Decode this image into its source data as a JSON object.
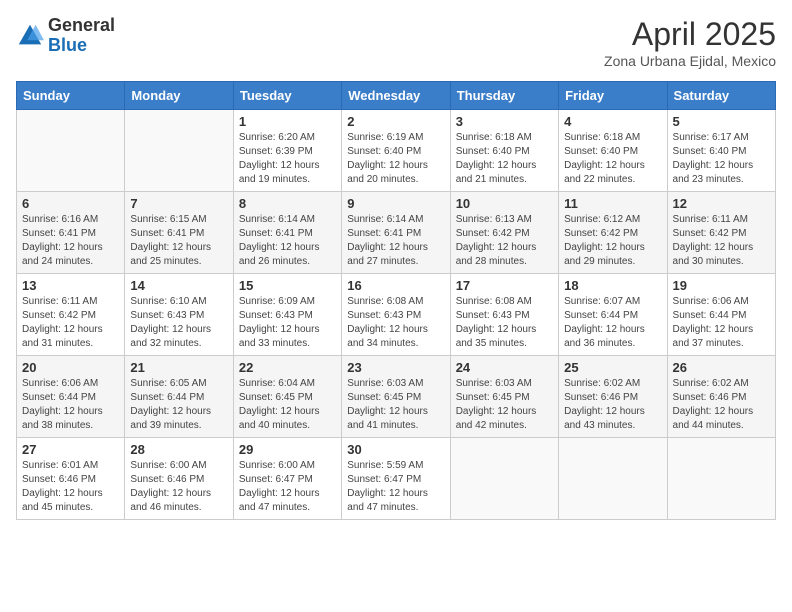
{
  "logo": {
    "general": "General",
    "blue": "Blue"
  },
  "title": "April 2025",
  "subtitle": "Zona Urbana Ejidal, Mexico",
  "headers": [
    "Sunday",
    "Monday",
    "Tuesday",
    "Wednesday",
    "Thursday",
    "Friday",
    "Saturday"
  ],
  "rows": [
    [
      {
        "day": "",
        "info": ""
      },
      {
        "day": "",
        "info": ""
      },
      {
        "day": "1",
        "info": "Sunrise: 6:20 AM\nSunset: 6:39 PM\nDaylight: 12 hours and 19 minutes."
      },
      {
        "day": "2",
        "info": "Sunrise: 6:19 AM\nSunset: 6:40 PM\nDaylight: 12 hours and 20 minutes."
      },
      {
        "day": "3",
        "info": "Sunrise: 6:18 AM\nSunset: 6:40 PM\nDaylight: 12 hours and 21 minutes."
      },
      {
        "day": "4",
        "info": "Sunrise: 6:18 AM\nSunset: 6:40 PM\nDaylight: 12 hours and 22 minutes."
      },
      {
        "day": "5",
        "info": "Sunrise: 6:17 AM\nSunset: 6:40 PM\nDaylight: 12 hours and 23 minutes."
      }
    ],
    [
      {
        "day": "6",
        "info": "Sunrise: 6:16 AM\nSunset: 6:41 PM\nDaylight: 12 hours and 24 minutes."
      },
      {
        "day": "7",
        "info": "Sunrise: 6:15 AM\nSunset: 6:41 PM\nDaylight: 12 hours and 25 minutes."
      },
      {
        "day": "8",
        "info": "Sunrise: 6:14 AM\nSunset: 6:41 PM\nDaylight: 12 hours and 26 minutes."
      },
      {
        "day": "9",
        "info": "Sunrise: 6:14 AM\nSunset: 6:41 PM\nDaylight: 12 hours and 27 minutes."
      },
      {
        "day": "10",
        "info": "Sunrise: 6:13 AM\nSunset: 6:42 PM\nDaylight: 12 hours and 28 minutes."
      },
      {
        "day": "11",
        "info": "Sunrise: 6:12 AM\nSunset: 6:42 PM\nDaylight: 12 hours and 29 minutes."
      },
      {
        "day": "12",
        "info": "Sunrise: 6:11 AM\nSunset: 6:42 PM\nDaylight: 12 hours and 30 minutes."
      }
    ],
    [
      {
        "day": "13",
        "info": "Sunrise: 6:11 AM\nSunset: 6:42 PM\nDaylight: 12 hours and 31 minutes."
      },
      {
        "day": "14",
        "info": "Sunrise: 6:10 AM\nSunset: 6:43 PM\nDaylight: 12 hours and 32 minutes."
      },
      {
        "day": "15",
        "info": "Sunrise: 6:09 AM\nSunset: 6:43 PM\nDaylight: 12 hours and 33 minutes."
      },
      {
        "day": "16",
        "info": "Sunrise: 6:08 AM\nSunset: 6:43 PM\nDaylight: 12 hours and 34 minutes."
      },
      {
        "day": "17",
        "info": "Sunrise: 6:08 AM\nSunset: 6:43 PM\nDaylight: 12 hours and 35 minutes."
      },
      {
        "day": "18",
        "info": "Sunrise: 6:07 AM\nSunset: 6:44 PM\nDaylight: 12 hours and 36 minutes."
      },
      {
        "day": "19",
        "info": "Sunrise: 6:06 AM\nSunset: 6:44 PM\nDaylight: 12 hours and 37 minutes."
      }
    ],
    [
      {
        "day": "20",
        "info": "Sunrise: 6:06 AM\nSunset: 6:44 PM\nDaylight: 12 hours and 38 minutes."
      },
      {
        "day": "21",
        "info": "Sunrise: 6:05 AM\nSunset: 6:44 PM\nDaylight: 12 hours and 39 minutes."
      },
      {
        "day": "22",
        "info": "Sunrise: 6:04 AM\nSunset: 6:45 PM\nDaylight: 12 hours and 40 minutes."
      },
      {
        "day": "23",
        "info": "Sunrise: 6:03 AM\nSunset: 6:45 PM\nDaylight: 12 hours and 41 minutes."
      },
      {
        "day": "24",
        "info": "Sunrise: 6:03 AM\nSunset: 6:45 PM\nDaylight: 12 hours and 42 minutes."
      },
      {
        "day": "25",
        "info": "Sunrise: 6:02 AM\nSunset: 6:46 PM\nDaylight: 12 hours and 43 minutes."
      },
      {
        "day": "26",
        "info": "Sunrise: 6:02 AM\nSunset: 6:46 PM\nDaylight: 12 hours and 44 minutes."
      }
    ],
    [
      {
        "day": "27",
        "info": "Sunrise: 6:01 AM\nSunset: 6:46 PM\nDaylight: 12 hours and 45 minutes."
      },
      {
        "day": "28",
        "info": "Sunrise: 6:00 AM\nSunset: 6:46 PM\nDaylight: 12 hours and 46 minutes."
      },
      {
        "day": "29",
        "info": "Sunrise: 6:00 AM\nSunset: 6:47 PM\nDaylight: 12 hours and 47 minutes."
      },
      {
        "day": "30",
        "info": "Sunrise: 5:59 AM\nSunset: 6:47 PM\nDaylight: 12 hours and 47 minutes."
      },
      {
        "day": "",
        "info": ""
      },
      {
        "day": "",
        "info": ""
      },
      {
        "day": "",
        "info": ""
      }
    ]
  ]
}
